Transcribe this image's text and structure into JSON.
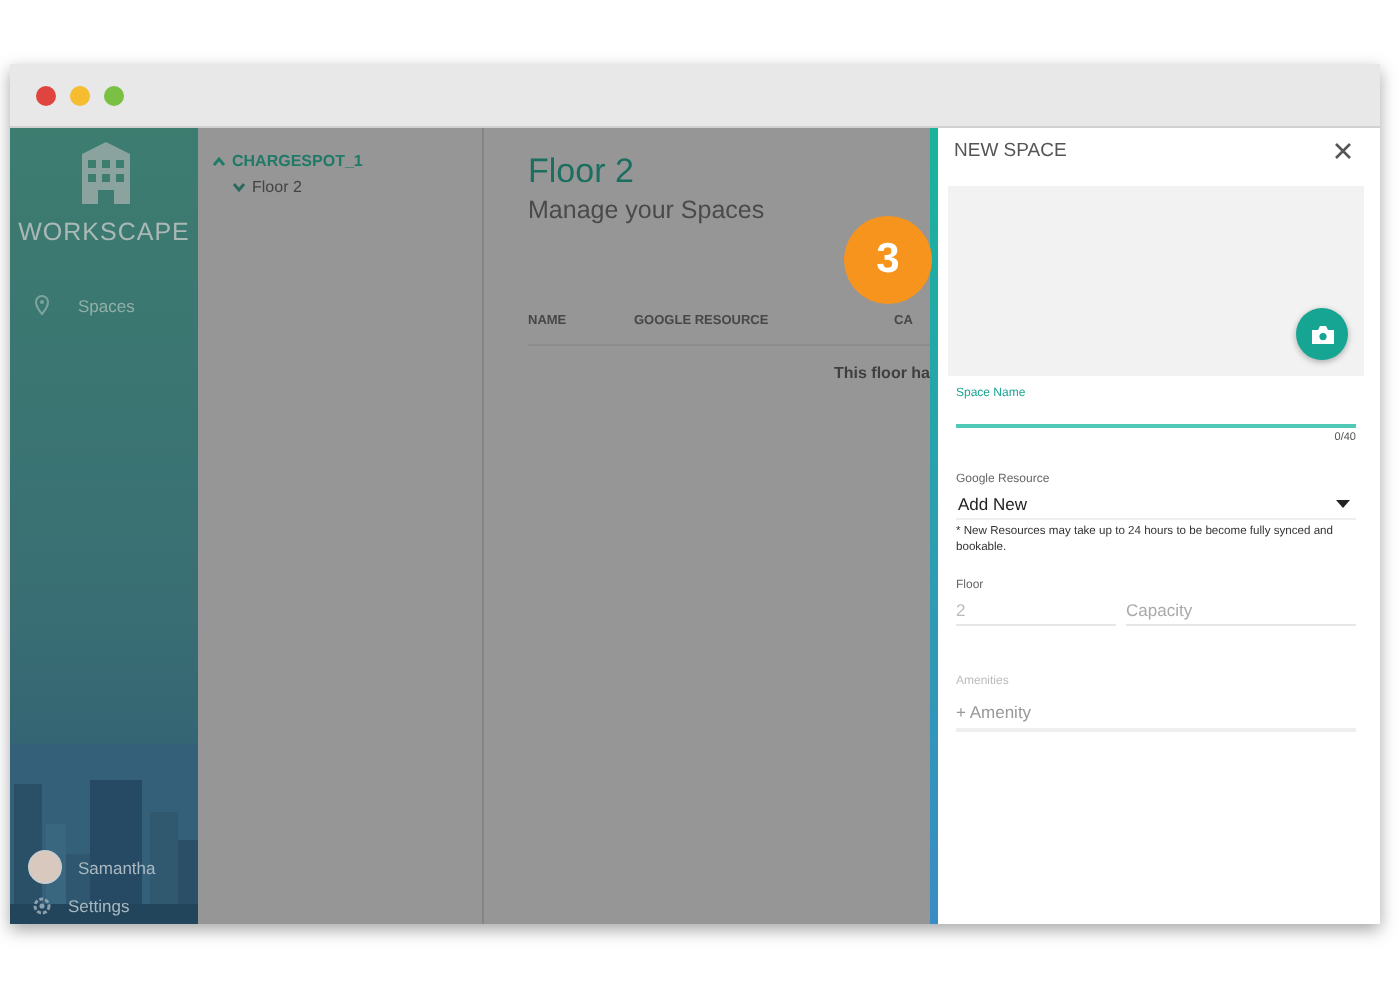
{
  "window": {
    "buttons": [
      {
        "color": "#e0443e"
      },
      {
        "color": "#f5bd2f"
      },
      {
        "color": "#7ac043"
      }
    ]
  },
  "sidebar": {
    "logo": "WORKSCAPE",
    "nav": [
      {
        "label": "Spaces"
      }
    ],
    "user": "Samantha",
    "settings": "Settings"
  },
  "tree": [
    {
      "label": "CHARGESPOT_1",
      "expanded": true,
      "children": [
        {
          "label": "Floor 2",
          "expanded": false
        }
      ]
    }
  ],
  "main": {
    "title": "Floor 2",
    "subtitle": "Manage your Spaces",
    "columns": [
      "NAME",
      "GOOGLE RESOURCE",
      "CA"
    ],
    "empty_message": "This floor ha"
  },
  "drawer": {
    "title": "NEW SPACE",
    "space_name": {
      "label": "Space Name",
      "counter": "0/40",
      "focused": true
    },
    "google_resource": {
      "label": "Google Resource",
      "value": "Add New",
      "note": "* New Resources may take up to 24 hours to be become fully synced and bookable."
    },
    "floor": {
      "label": "Floor",
      "value": "2",
      "disabled": true
    },
    "capacity": {
      "placeholder": "Capacity"
    },
    "amenities": {
      "label": "Amenities",
      "placeholder": "+ Amenity"
    }
  },
  "badge": "3"
}
